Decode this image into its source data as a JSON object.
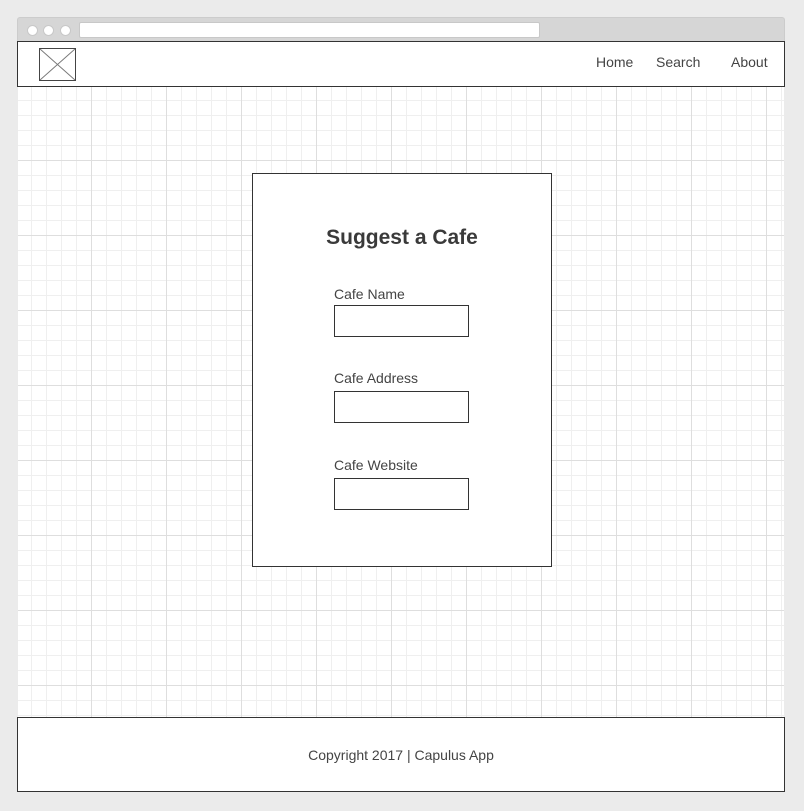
{
  "nav": {
    "items": [
      {
        "label": "Home"
      },
      {
        "label": "Search"
      },
      {
        "label": "About"
      }
    ]
  },
  "logo": {
    "icon": "image-placeholder-icon"
  },
  "form": {
    "title": "Suggest a Cafe",
    "fields": [
      {
        "label": "Cafe Name",
        "value": ""
      },
      {
        "label": "Cafe Address",
        "value": ""
      },
      {
        "label": "Cafe Website",
        "value": ""
      }
    ]
  },
  "footer": {
    "copyright": "Copyright 2017 | Capulus App"
  }
}
